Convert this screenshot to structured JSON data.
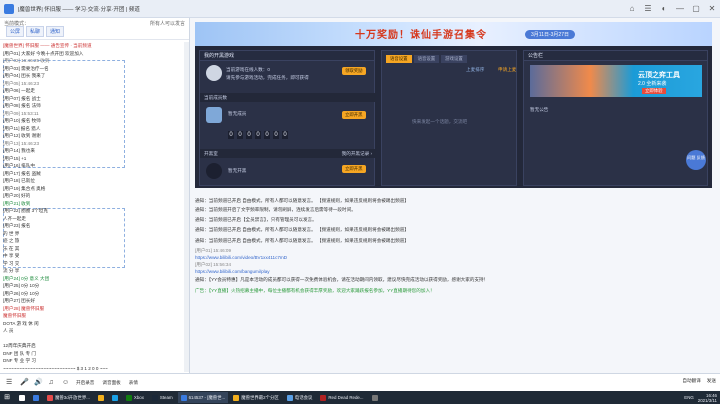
{
  "window": {
    "title": "|魔兽世界| 怀旧服 —— 学习·交流·分享·开团 | 频道",
    "controls": [
      "⌂",
      "☰",
      "◐",
      "—",
      "▢",
      "✕"
    ]
  },
  "left": {
    "tabs": [
      "公屏",
      "私聊",
      "通知"
    ],
    "header_right": "所有人可以发言",
    "header_label": "当前模式：",
    "messages": [
      {
        "t": "[魔兽世界] 怀旧服 —— 通告宣传 · 当前频道",
        "c": "sys"
      },
      {
        "t": "[用户01] 大家好 今晚十点开团 欢迎加入",
        "c": ""
      },
      {
        "t": "[用户02] 16:46:25 收到",
        "c": "dim"
      },
      {
        "t": "[用户03] 需要治疗一名",
        "c": ""
      },
      {
        "t": "[用户04] 团长 我来了",
        "c": ""
      },
      {
        "t": "[用户05] 15:46:23",
        "c": "dim"
      },
      {
        "t": "[用户06] 一起走",
        "c": ""
      },
      {
        "t": "[用户07] 报名 战士",
        "c": ""
      },
      {
        "t": "[用户08] 报名 法师",
        "c": ""
      },
      {
        "t": "[用户09] 15:53:11",
        "c": "dim"
      },
      {
        "t": "[用户10] 报名 牧师",
        "c": ""
      },
      {
        "t": "[用户11] 报名 猎人",
        "c": ""
      },
      {
        "t": "[用户12] 收到 谢谢",
        "c": ""
      },
      {
        "t": "[用户13] 15:46:23",
        "c": "dim"
      },
      {
        "t": "[用户14] 我也来",
        "c": ""
      },
      {
        "t": "[用户15] +1",
        "c": ""
      },
      {
        "t": "[用户16] 排队中",
        "c": ""
      },
      {
        "t": "[用户17] 报名 盗贼",
        "c": ""
      },
      {
        "t": "[用户18] 已就位",
        "c": ""
      },
      {
        "t": "[用户19] 集合点 奥格",
        "c": ""
      },
      {
        "t": "[用户20] 好的",
        "c": ""
      },
      {
        "t": "[用户21] 收到",
        "c": "tag"
      },
      {
        "t": "[用户22] 圈圈 3个坦克",
        "c": ""
      },
      {
        "t": "        人齐一起走",
        "c": ""
      },
      {
        "t": "[用户23] 报名",
        "c": ""
      },
      {
        "t": "  的   世   界",
        "c": ""
      },
      {
        "t": "  迹   之   旅",
        "c": ""
      },
      {
        "t": "  乐   在   其",
        "c": ""
      },
      {
        "t": "  中   享   受",
        "c": ""
      },
      {
        "t": "  学   习   交",
        "c": ""
      },
      {
        "t": "  流   分   享",
        "c": ""
      },
      {
        "t": "[用户24] 0分 意义 大团",
        "c": "tag"
      },
      {
        "t": "[用户25] 0分 10分",
        "c": ""
      },
      {
        "t": "[用户26] 0分 10分",
        "c": ""
      },
      {
        "t": "[用户27] 团长好",
        "c": ""
      },
      {
        "t": "[用户28] 魔兽怀旧服",
        "c": "sys"
      },
      {
        "t": "          魔兽怀旧服",
        "c": "sys"
      },
      {
        "t": "      DOTA 游 戏 休 闲",
        "c": ""
      },
      {
        "t": "          人 员",
        "c": ""
      },
      {
        "t": "",
        "c": ""
      },
      {
        "t": "      12周年庆典开启",
        "c": ""
      },
      {
        "t": "      DNF 团 队 专 门",
        "c": ""
      },
      {
        "t": "      DNF 专 业 学 习",
        "c": ""
      },
      {
        "t": "  ~~~~~~~~~~~~~~~~~~~~~~~~~~~ $ 3 1 2 0 0 ~~~",
        "c": ""
      }
    ]
  },
  "banner": {
    "title": "十万奖励！诛仙手游召集令",
    "date": "3月11日-3月27日"
  },
  "panels": {
    "my_game": {
      "title": "我的开黑游戏",
      "owner_line1": "当前游戏在线人数：0",
      "owner_line2": "请先参与游戏活动，完成任务，即可获得",
      "owner_btn": "领取奖励",
      "sec1_title": "当前成员数",
      "sec1_name": "暂无成员",
      "sec1_btn": "立即开黑",
      "digits": [
        "0",
        "0",
        "0",
        "0",
        "0",
        "0",
        "0"
      ],
      "sec2_title": "开黑室",
      "sec2_right": "我的开黑记录 ›",
      "sec2_name": "暂无开黑",
      "sec2_btn": "立即开黑"
    },
    "center": {
      "tabs": [
        "语音设置",
        "语音设置",
        "游戏设置"
      ],
      "side_label": "上麦排序",
      "side_btn": "申请上麦",
      "empty": "快来发起一个话题，交流吧"
    },
    "ads": {
      "title": "公告栏",
      "ad_title": "云顶之弈工具",
      "ad_sub": "2.0 全新来袭",
      "ad_btn": "立即体验",
      "notice": "暂无公告"
    },
    "float_btn": "问题\n反馈"
  },
  "lower": [
    {
      "t": "通知：当前频道已开启 自由模式，所有人都可以随意发言。 【频道规则，如果违反规则将会被踢出频道】",
      "c": ""
    },
    {
      "t": "通知：当前频道开启了文字频率限制，请勿刷屏，连续发言后需等待一段时间。",
      "c": ""
    },
    {
      "t": "通知：当前频道已开启【全员禁言】，只有管理员可以发言。",
      "c": ""
    },
    {
      "t": "通知：当前频道已开启 自由模式，所有人都可以随意发言。 【频道规则，如果违反规则将会被踢出频道】",
      "c": ""
    },
    {
      "t": "通知：当前频道已开启 自由模式，所有人都可以随意发言。 【频道规则，如果违反规则将会被踢出频道】",
      "c": ""
    },
    {
      "t": "[用户01] 15:46:09",
      "c": "gray"
    },
    {
      "t": "https://www.bilibili.com/video/BV1xx411c7mD",
      "c": "blue"
    },
    {
      "t": "[用户02] 15:56:34",
      "c": "gray"
    },
    {
      "t": "https://www.bilibili.com/bangumi/play",
      "c": "blue"
    },
    {
      "t": "通知：【YY会员特惠】凡是本活动的成员都可以获得一次免费体验机会，请在活动期间内领取，建议尽快完成活动以获得奖励，感谢大家的支持！",
      "c": ""
    },
    {
      "t": "广告：【YY直播】火热招募主播中，每位主播都有机会获得丰厚奖励，欢迎大家踊跃报名参加，YY直播期待您的加入！",
      "c": "green"
    }
  ],
  "inputbar": {
    "items": [
      "☰",
      "🎤",
      "🔊",
      "♫",
      "☺"
    ],
    "labels": [
      "开启录音",
      "调音面板",
      "表情"
    ],
    "right": [
      "自动翻译",
      "发送"
    ]
  },
  "taskbar": {
    "items": [
      {
        "label": "",
        "color": "#ffffff"
      },
      {
        "label": "",
        "color": "#3a7be0"
      },
      {
        "label": "魔兽3d开放世界...",
        "color": "#e54b4b"
      },
      {
        "label": "",
        "color": "#f2b01e"
      },
      {
        "label": "",
        "color": "#1aa1e6"
      },
      {
        "label": "Xbox",
        "color": "#107c10"
      },
      {
        "label": "Steam",
        "color": "#1b2838"
      },
      {
        "label": "614537 - [魔兽世...",
        "color": "#3a7be0"
      },
      {
        "label": "魔兽世界最2个分区",
        "color": "#f2b01e"
      },
      {
        "label": "电话会议",
        "color": "#5aa0e6"
      },
      {
        "label": "Red Dead Rede...",
        "color": "#b22222"
      },
      {
        "label": "",
        "color": "#777777"
      }
    ],
    "tray": [
      "ENG"
    ],
    "time": "2021/3/11",
    "clock": "16:46"
  }
}
